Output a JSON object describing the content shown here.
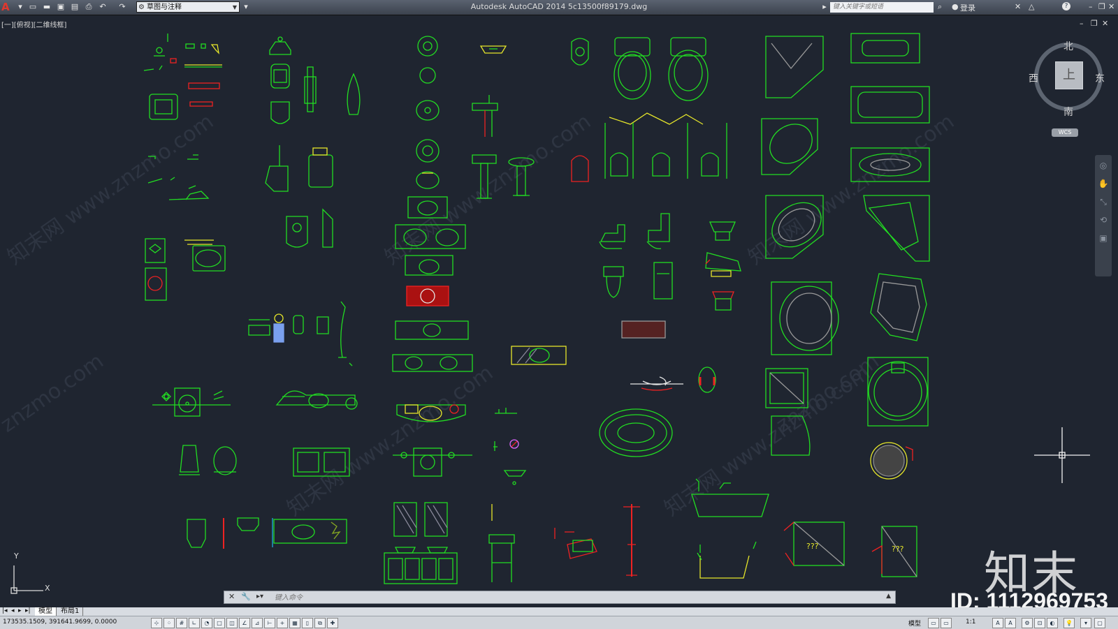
{
  "window": {
    "app_title": "Autodesk AutoCAD 2014    5c13500f89179.dwg",
    "workspace": "草图与注释",
    "search_placeholder": "键入关键字或短语",
    "login": "登录",
    "help": "?"
  },
  "viewport": {
    "label": "[一][俯视][二维线框]"
  },
  "viewcube": {
    "north": "北",
    "south": "南",
    "east": "东",
    "west": "西",
    "face": "上",
    "wcs": "WCS"
  },
  "ucs": {
    "x": "X",
    "y": "Y"
  },
  "command": {
    "placeholder": "键入命令"
  },
  "layout_tabs": [
    "模型",
    "布局1"
  ],
  "status": {
    "coordinates": "173535.1509,  391641.9699,  0.0000",
    "model_label": "模型",
    "scale": "1:1"
  },
  "watermark": {
    "logo": "知末",
    "id": "ID: 1112969753",
    "site": "znzmo.com",
    "site_cn": "知末网 www.znzmo.com"
  },
  "colors": {
    "canvas_bg": "#1f2530",
    "cad_green": "#22dd22",
    "cad_red": "#ee2222",
    "cad_yellow": "#e6e62a"
  }
}
